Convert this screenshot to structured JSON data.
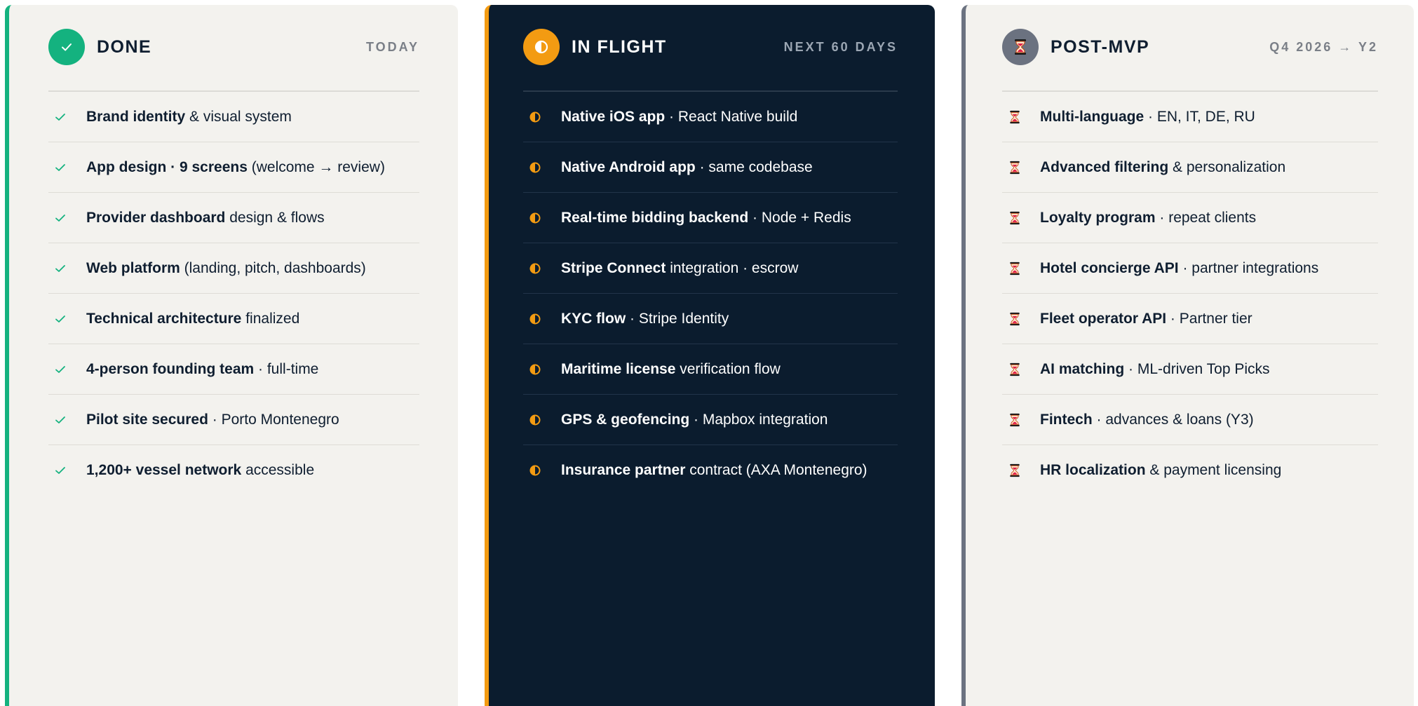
{
  "colors": {
    "done_accent": "#14b27f",
    "flight_accent": "#f39b12",
    "post_accent": "#6b7280",
    "dark_panel": "#0b1c2e",
    "light_panel": "#f3f2ee"
  },
  "columns": [
    {
      "id": "done",
      "icon": "check-icon",
      "title": "DONE",
      "meta": "TODAY",
      "items": [
        {
          "strong": "Brand identity",
          "rest": " & visual system"
        },
        {
          "strong": "App design · 9 screens",
          "rest": " (welcome → review)"
        },
        {
          "strong": "Provider dashboard",
          "rest": " design & flows"
        },
        {
          "strong": "Web platform",
          "rest": " (landing, pitch, dashboards)"
        },
        {
          "strong": "Technical architecture",
          "rest": " finalized"
        },
        {
          "strong": "4-person founding team",
          "rest": " · full-time"
        },
        {
          "strong": "Pilot site secured",
          "rest": " · Porto Montenegro"
        },
        {
          "strong": "1,200+ vessel network",
          "rest": " accessible"
        }
      ]
    },
    {
      "id": "flight",
      "icon": "half-circle-icon",
      "title": "IN FLIGHT",
      "meta": "NEXT 60 DAYS",
      "items": [
        {
          "strong": "Native iOS app",
          "rest": " · React Native build"
        },
        {
          "strong": "Native Android app",
          "rest": " · same codebase"
        },
        {
          "strong": "Real-time bidding backend",
          "rest": " · Node + Redis"
        },
        {
          "strong": "Stripe Connect",
          "rest": " integration · escrow"
        },
        {
          "strong": "KYC flow",
          "rest": " · Stripe Identity"
        },
        {
          "strong": "Maritime license",
          "rest": " verification flow"
        },
        {
          "strong": "GPS & geofencing",
          "rest": " · Mapbox integration"
        },
        {
          "strong": "Insurance partner",
          "rest": " contract (AXA Montenegro)"
        }
      ]
    },
    {
      "id": "post",
      "icon": "hourglass-icon",
      "title": "POST-MVP",
      "meta": "Q4 2026 → Y2",
      "items": [
        {
          "strong": "Multi-language",
          "rest": " · EN, IT, DE, RU"
        },
        {
          "strong": "Advanced filtering",
          "rest": " & personalization"
        },
        {
          "strong": "Loyalty program",
          "rest": " · repeat clients"
        },
        {
          "strong": "Hotel concierge API",
          "rest": " · partner integrations"
        },
        {
          "strong": "Fleet operator API",
          "rest": " · Partner tier"
        },
        {
          "strong": "AI matching",
          "rest": " · ML-driven Top Picks"
        },
        {
          "strong": "Fintech",
          "rest": " · advances & loans (Y3)"
        },
        {
          "strong": "HR localization",
          "rest": " & payment licensing"
        }
      ]
    }
  ]
}
